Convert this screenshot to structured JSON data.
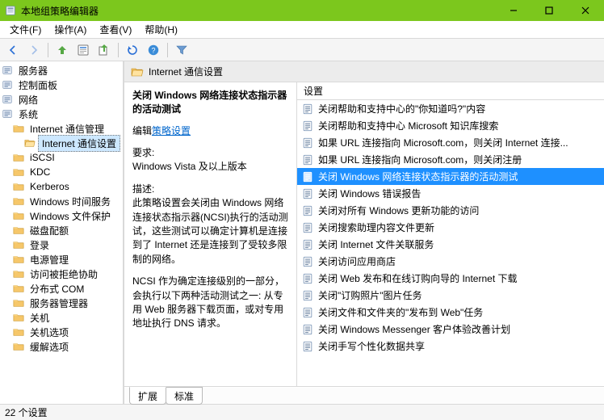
{
  "window": {
    "title": "本地组策略编辑器"
  },
  "menu": {
    "file": "文件(F)",
    "action": "操作(A)",
    "view": "查看(V)",
    "help": "帮助(H)"
  },
  "tree": {
    "items": [
      {
        "label": "服务器",
        "depth": 0,
        "icon": "node"
      },
      {
        "label": "控制面板",
        "depth": 0,
        "icon": "node"
      },
      {
        "label": "网络",
        "depth": 0,
        "icon": "node"
      },
      {
        "label": "系统",
        "depth": 0,
        "icon": "node"
      },
      {
        "label": "Internet 通信管理",
        "depth": 1,
        "icon": "folder"
      },
      {
        "label": "Internet 通信设置",
        "depth": 2,
        "icon": "folder",
        "selected": true
      },
      {
        "label": "iSCSI",
        "depth": 1,
        "icon": "folder"
      },
      {
        "label": "KDC",
        "depth": 1,
        "icon": "folder"
      },
      {
        "label": "Kerberos",
        "depth": 1,
        "icon": "folder"
      },
      {
        "label": "Windows 时间服务",
        "depth": 1,
        "icon": "folder"
      },
      {
        "label": "Windows 文件保护",
        "depth": 1,
        "icon": "folder"
      },
      {
        "label": "磁盘配额",
        "depth": 1,
        "icon": "folder"
      },
      {
        "label": "登录",
        "depth": 1,
        "icon": "folder"
      },
      {
        "label": "电源管理",
        "depth": 1,
        "icon": "folder"
      },
      {
        "label": "访问被拒绝协助",
        "depth": 1,
        "icon": "folder"
      },
      {
        "label": "分布式 COM",
        "depth": 1,
        "icon": "folder"
      },
      {
        "label": "服务器管理器",
        "depth": 1,
        "icon": "folder"
      },
      {
        "label": "关机",
        "depth": 1,
        "icon": "folder"
      },
      {
        "label": "关机选项",
        "depth": 1,
        "icon": "folder"
      },
      {
        "label": "缓解选项",
        "depth": 1,
        "icon": "folder"
      }
    ]
  },
  "content": {
    "header_icon": "folder",
    "header_title": "Internet 通信设置",
    "detail": {
      "title": "关闭 Windows 网络连接状态指示器的活动测试",
      "edit_label": "编辑",
      "edit_link": "策略设置",
      "req_label": "要求:",
      "req_value": "Windows Vista 及以上版本",
      "desc_label": "描述:",
      "desc_p1": "此策略设置会关闭由 Windows 网络连接状态指示器(NCSI)执行的活动测试，这些测试可以确定计算机是连接到了 Internet 还是连接到了受较多限制的网络。",
      "desc_p2": "NCSI 作为确定连接级别的一部分，会执行以下两种活动测试之一: 从专用 Web 服务器下载页面，或对专用地址执行 DNS 请求。"
    },
    "list": {
      "header": "设置",
      "items": [
        {
          "label": "关闭帮助和支持中心的\"你知道吗?\"内容"
        },
        {
          "label": "关闭帮助和支持中心 Microsoft 知识库搜索"
        },
        {
          "label": "如果 URL 连接指向 Microsoft.com，则关闭 Internet 连接..."
        },
        {
          "label": "如果 URL 连接指向 Microsoft.com，则关闭注册"
        },
        {
          "label": "关闭 Windows 网络连接状态指示器的活动测试",
          "selected": true
        },
        {
          "label": "关闭 Windows 错误报告"
        },
        {
          "label": "关闭对所有 Windows 更新功能的访问"
        },
        {
          "label": "关闭搜索助理内容文件更新"
        },
        {
          "label": "关闭 Internet 文件关联服务"
        },
        {
          "label": "关闭访问应用商店"
        },
        {
          "label": "关闭 Web 发布和在线订购向导的 Internet 下载"
        },
        {
          "label": "关闭\"订购照片\"图片任务"
        },
        {
          "label": "关闭文件和文件夹的\"发布到 Web\"任务"
        },
        {
          "label": "关闭 Windows Messenger 客户体验改善计划"
        },
        {
          "label": "关闭手写个性化数据共享"
        }
      ]
    }
  },
  "tabs": {
    "extended": "扩展",
    "standard": "标准"
  },
  "status": {
    "text": "22 个设置"
  }
}
